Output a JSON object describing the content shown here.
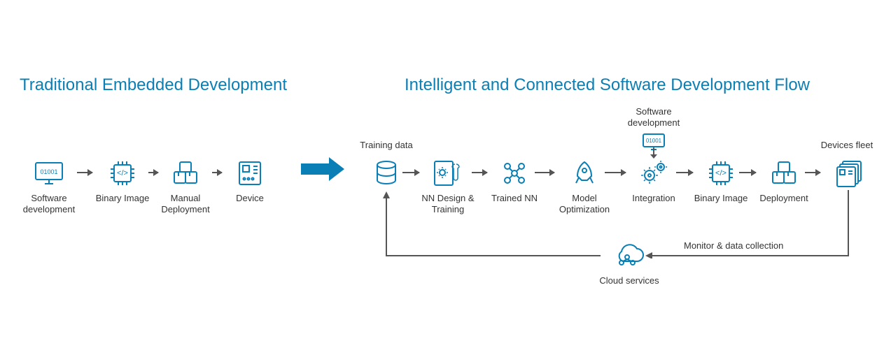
{
  "colors": {
    "accent": "#0a7fb5",
    "line": "#555"
  },
  "titles": {
    "left": "Traditional Embedded Development",
    "right": "Intelligent and Connected Software Development Flow"
  },
  "traditional": {
    "nodes": [
      {
        "id": "sw-dev",
        "icon": "monitor-code",
        "label": "Software development"
      },
      {
        "id": "binary-image",
        "icon": "chip-code",
        "label": "Binary Image"
      },
      {
        "id": "manual-deploy",
        "icon": "boxes",
        "label": "Manual Deployment"
      },
      {
        "id": "device",
        "icon": "pcb",
        "label": "Device"
      }
    ]
  },
  "intelligent": {
    "above": [
      {
        "target": "training-data",
        "label": "Training data"
      },
      {
        "target": "integration",
        "label": "Software development",
        "extra_icon": "monitor-code"
      },
      {
        "target": "devices-fleet",
        "label": "Devices fleet"
      }
    ],
    "nodes": [
      {
        "id": "training-data",
        "icon": "database",
        "label": ""
      },
      {
        "id": "nn-design",
        "icon": "doc-gear-wrench",
        "label": "NN Design & Training"
      },
      {
        "id": "trained-nn",
        "icon": "network",
        "label": "Trained NN"
      },
      {
        "id": "model-opt",
        "icon": "rocket",
        "label": "Model Optimization"
      },
      {
        "id": "integration",
        "icon": "gears",
        "label": "Integration"
      },
      {
        "id": "binary-image-2",
        "icon": "chip-code",
        "label": "Binary Image"
      },
      {
        "id": "deployment",
        "icon": "boxes",
        "label": "Deployment"
      },
      {
        "id": "devices-fleet",
        "icon": "device-stack",
        "label": ""
      }
    ],
    "feedback": {
      "cloud_label": "Cloud services",
      "monitor_label": "Monitor & data collection"
    }
  }
}
